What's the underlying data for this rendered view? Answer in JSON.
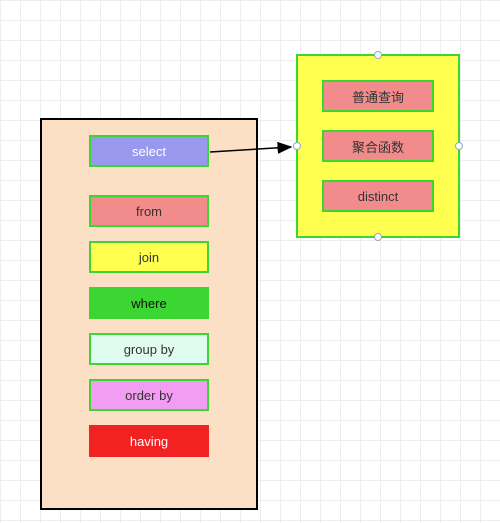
{
  "main": {
    "blocks": [
      {
        "label": "select"
      },
      {
        "label": "from"
      },
      {
        "label": "join"
      },
      {
        "label": "where"
      },
      {
        "label": "group by"
      },
      {
        "label": "order by"
      },
      {
        "label": "having"
      }
    ]
  },
  "detail": {
    "blocks": [
      {
        "label": "普通查询"
      },
      {
        "label": "聚合函数"
      },
      {
        "label": "distinct"
      }
    ]
  }
}
